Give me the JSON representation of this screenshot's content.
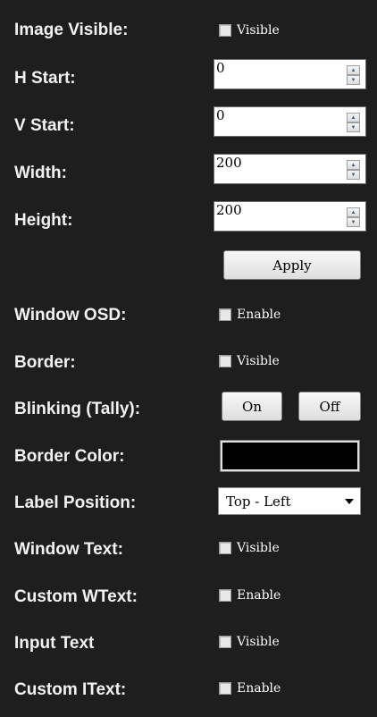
{
  "rows": {
    "image_visible": {
      "label": "Image Visible:",
      "checkbox_label": "Visible"
    },
    "h_start": {
      "label": "H Start:",
      "value": "0"
    },
    "v_start": {
      "label": "V Start:",
      "value": "0"
    },
    "width": {
      "label": "Width:",
      "value": "200"
    },
    "height": {
      "label": "Height:",
      "value": "200"
    },
    "apply_label": "Apply",
    "window_osd": {
      "label": "Window OSD:",
      "checkbox_label": "Enable"
    },
    "border": {
      "label": "Border:",
      "checkbox_label": "Visible"
    },
    "blinking": {
      "label": "Blinking (Tally):",
      "on_label": "On",
      "off_label": "Off"
    },
    "border_color": {
      "label": "Border Color:",
      "color": "#000000"
    },
    "label_position": {
      "label": "Label Position:",
      "selected": "Top - Left"
    },
    "window_text": {
      "label": "Window Text:",
      "checkbox_label": "Visible"
    },
    "custom_wtext": {
      "label": "Custom WText:",
      "checkbox_label": "Enable"
    },
    "input_text": {
      "label": "Input Text",
      "checkbox_label": "Visible"
    },
    "custom_itext": {
      "label": "Custom IText:",
      "checkbox_label": "Enable"
    }
  },
  "colors": {
    "panel_bg": "#1e1e1e",
    "label_text": "#f2f2f2"
  }
}
